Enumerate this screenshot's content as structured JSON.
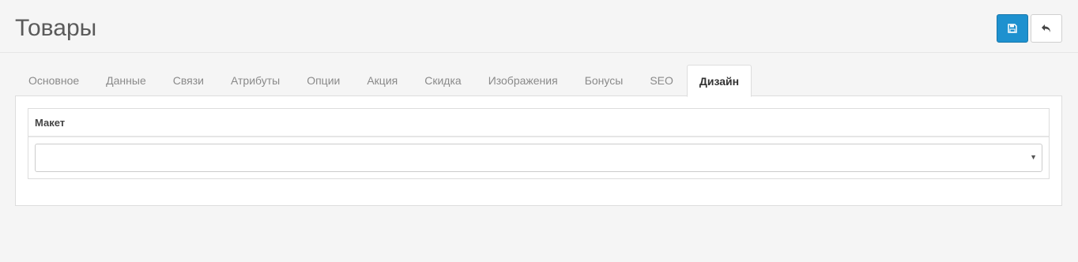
{
  "header": {
    "title": "Товары",
    "save_icon": "save-icon",
    "back_icon": "reply-icon",
    "save_color": "#1e91cf"
  },
  "tabs": [
    {
      "label": "Основное",
      "active": false
    },
    {
      "label": "Данные",
      "active": false
    },
    {
      "label": "Связи",
      "active": false
    },
    {
      "label": "Атрибуты",
      "active": false
    },
    {
      "label": "Опции",
      "active": false
    },
    {
      "label": "Акция",
      "active": false
    },
    {
      "label": "Скидка",
      "active": false
    },
    {
      "label": "Изображения",
      "active": false
    },
    {
      "label": "Бонусы",
      "active": false
    },
    {
      "label": "SEO",
      "active": false
    },
    {
      "label": "Дизайн",
      "active": true
    }
  ],
  "design": {
    "column_header": "Макет",
    "layout_value": ""
  }
}
